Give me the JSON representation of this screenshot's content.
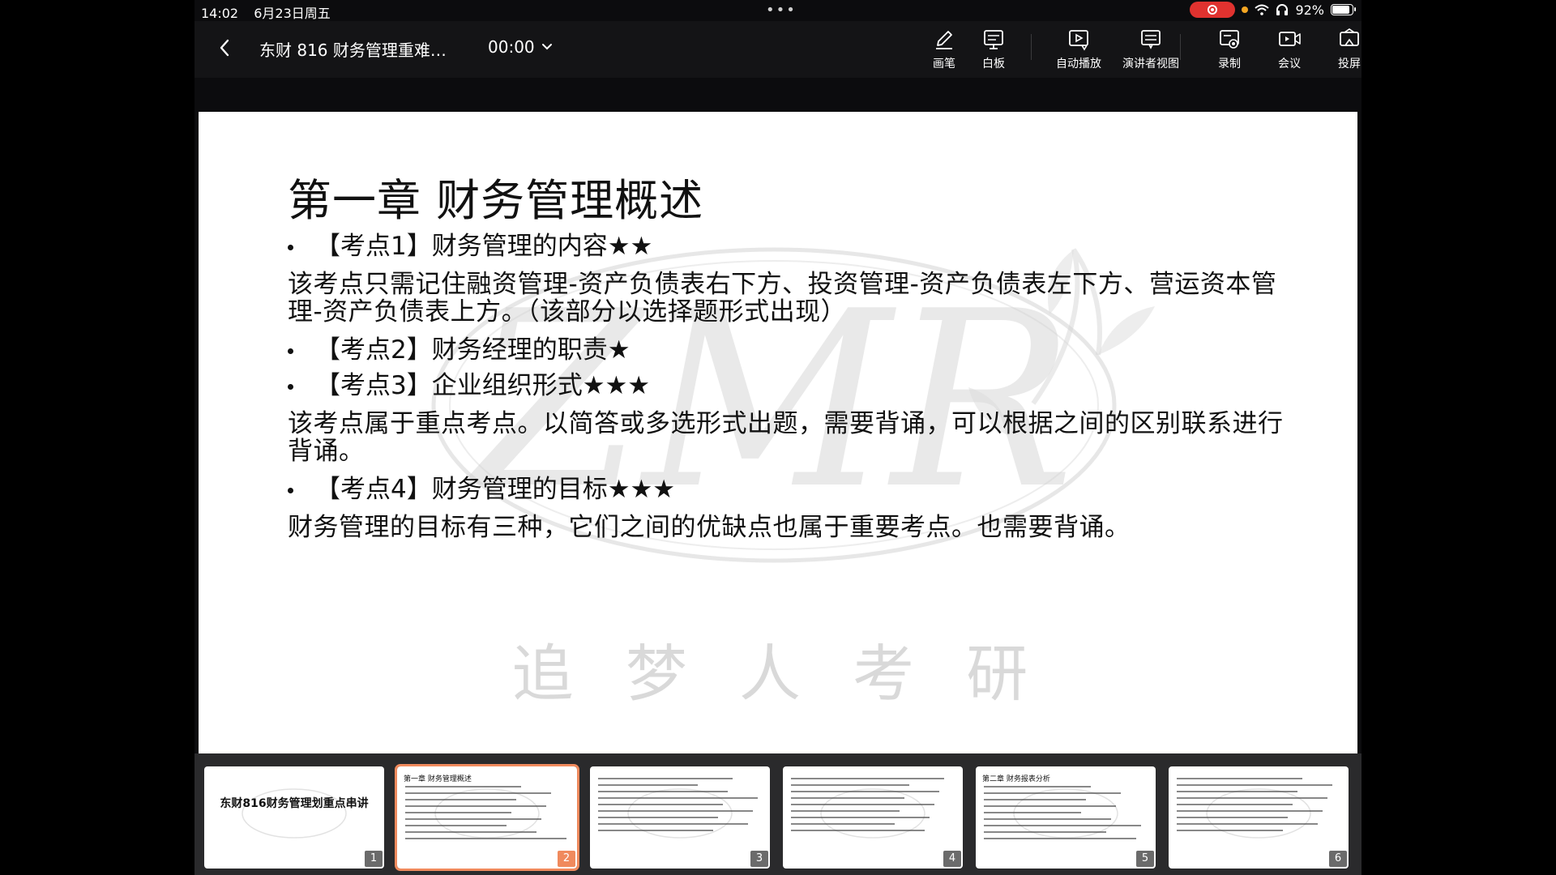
{
  "status_bar": {
    "time": "14:02",
    "date": "6月23日周五",
    "battery": "92%",
    "battery_level": 0.92,
    "record_color": "#e0322f"
  },
  "toolbar": {
    "title": "东财 816 财务管理重难…",
    "timer": "00:00",
    "tools": [
      {
        "label": "画笔",
        "icon": "pen-icon"
      },
      {
        "label": "白板",
        "icon": "whiteboard-icon"
      },
      {
        "label": "自动播放",
        "icon": "autoplay-icon"
      },
      {
        "label": "演讲者视图",
        "icon": "presenter-view-icon"
      },
      {
        "label": "录制",
        "icon": "record-icon"
      },
      {
        "label": "会议",
        "icon": "meeting-icon"
      },
      {
        "label": "投屏",
        "icon": "cast-icon"
      }
    ]
  },
  "slide": {
    "title": "第一章  财务管理概述",
    "blocks": [
      {
        "type": "bullet",
        "text": "【考点1】财务管理的内容★★"
      },
      {
        "type": "para",
        "text": "该考点只需记住融资管理-资产负债表右下方、投资管理-资产负债表左下方、营运资本管理-资产负债表上方。（该部分以选择题形式出现）"
      },
      {
        "type": "bullet",
        "text": "【考点2】财务经理的职责★"
      },
      {
        "type": "bullet",
        "text": "【考点3】企业组织形式★★★"
      },
      {
        "type": "para",
        "text": "该考点属于重点考点。以简答或多选形式出题，需要背诵，可以根据之间的区别联系进行背诵。"
      },
      {
        "type": "bullet",
        "text": "【考点4】财务管理的目标★★★"
      },
      {
        "type": "para",
        "text": "财务管理的目标有三种，它们之间的优缺点也属于重要考点。也需要背诵。"
      }
    ],
    "watermark_text": "追 梦 人 考 研",
    "watermark_logo": "ZMR"
  },
  "filmstrip": {
    "active_index": 1,
    "accent": "#f08a5d",
    "thumbs": [
      {
        "num": "1",
        "kind": "cover",
        "title": "东财816财务管理划重点串讲"
      },
      {
        "num": "2",
        "kind": "content",
        "title": "第一章  财务管理概述"
      },
      {
        "num": "3",
        "kind": "content",
        "title": ""
      },
      {
        "num": "4",
        "kind": "content",
        "title": ""
      },
      {
        "num": "5",
        "kind": "content",
        "title": "第二章  财务报表分析"
      },
      {
        "num": "6",
        "kind": "content",
        "title": ""
      }
    ]
  }
}
